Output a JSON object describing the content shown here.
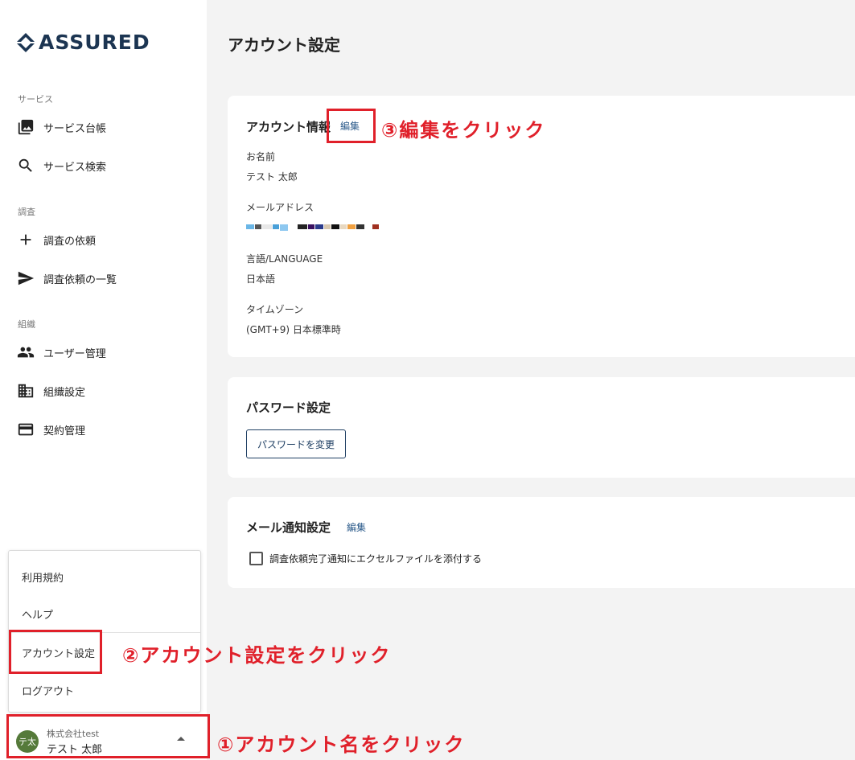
{
  "brand": {
    "name": "ASSURED",
    "color": "#1c3552"
  },
  "sidebar": {
    "sections": [
      {
        "label": "サービス"
      },
      {
        "label": "調査"
      },
      {
        "label": "組織"
      }
    ],
    "items": [
      {
        "label": "サービス台帳",
        "icon": "photo-library-icon"
      },
      {
        "label": "サービス検索",
        "icon": "search-icon"
      },
      {
        "label": "調査の依頼",
        "icon": "plus-icon"
      },
      {
        "label": "調査依頼の一覧",
        "icon": "send-icon"
      },
      {
        "label": "ユーザー管理",
        "icon": "people-icon"
      },
      {
        "label": "組織設定",
        "icon": "building-icon"
      },
      {
        "label": "契約管理",
        "icon": "credit-card-icon"
      }
    ]
  },
  "popup_menu": {
    "items": [
      "利用規約",
      "ヘルプ",
      "アカウント設定",
      "ログアウト"
    ]
  },
  "account": {
    "avatar_text": "テ太",
    "company": "株式会社test",
    "name": "テスト 太郎"
  },
  "main": {
    "title": "アカウント設定",
    "account_info": {
      "title": "アカウント情報",
      "edit_label": "編集",
      "fields": [
        {
          "label": "お名前",
          "value": "テスト 太郎"
        },
        {
          "label": "メールアドレス",
          "value": ""
        },
        {
          "label": "言語/LANGUAGE",
          "value": "日本語"
        },
        {
          "label": "タイムゾーン",
          "value": "(GMT+9) 日本標準時"
        }
      ]
    },
    "password": {
      "title": "パスワード設定",
      "button_label": "パスワードを変更"
    },
    "mail_notification": {
      "title": "メール通知設定",
      "edit_label": "編集",
      "checkbox_label": "調査依頼完了通知にエクセルファイルを添付する",
      "checked": false
    }
  },
  "annotations": {
    "step1": "①アカウント名をクリック",
    "step2": "②アカウント設定をクリック",
    "step3": "③編集をクリック",
    "color": "#e0202a"
  }
}
